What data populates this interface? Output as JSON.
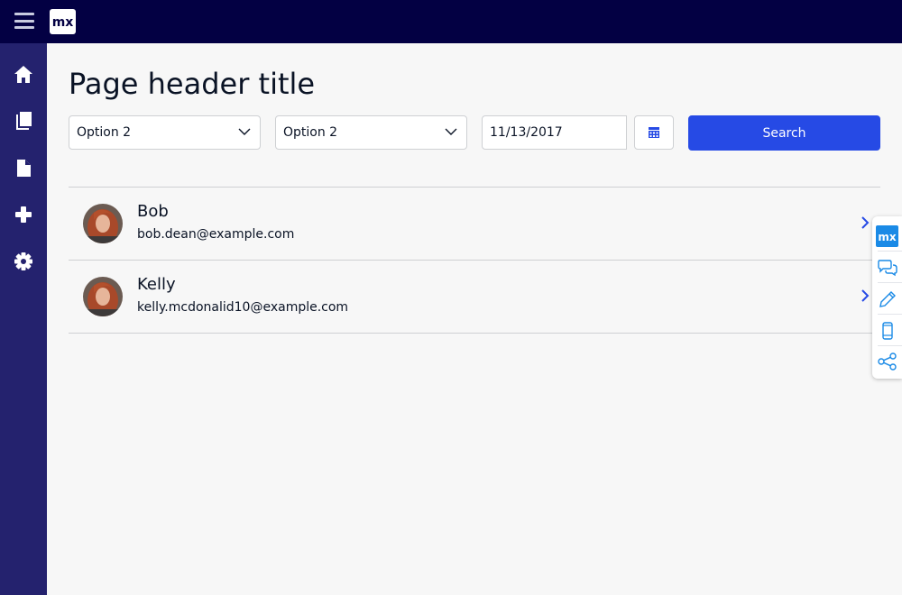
{
  "app": {
    "logo_text": "mx",
    "colors": {
      "topbar": "#030043",
      "sidebar": "#24226e",
      "accent": "#264ae5"
    }
  },
  "sidebar": {
    "items": [
      {
        "icon": "home-icon"
      },
      {
        "icon": "book-icon"
      },
      {
        "icon": "file-icon"
      },
      {
        "icon": "plus-icon"
      },
      {
        "icon": "gear-icon"
      }
    ]
  },
  "page": {
    "title": "Page header title"
  },
  "filters": {
    "select1": {
      "value": "Option 2"
    },
    "select2": {
      "value": "Option 2"
    },
    "date": {
      "value": "11/13/2017"
    },
    "search_label": "Search"
  },
  "list": {
    "items": [
      {
        "name": "Bob",
        "email": "bob.dean@example.com"
      },
      {
        "name": "Kelly",
        "email": "kelly.mcdonalid10@example.com"
      }
    ]
  },
  "dev_tools": {
    "logo_text": "mx",
    "items": [
      {
        "icon": "chat-bubbles-icon"
      },
      {
        "icon": "pencil-icon"
      },
      {
        "icon": "mobile-phone-icon"
      },
      {
        "icon": "share-icon"
      }
    ]
  }
}
